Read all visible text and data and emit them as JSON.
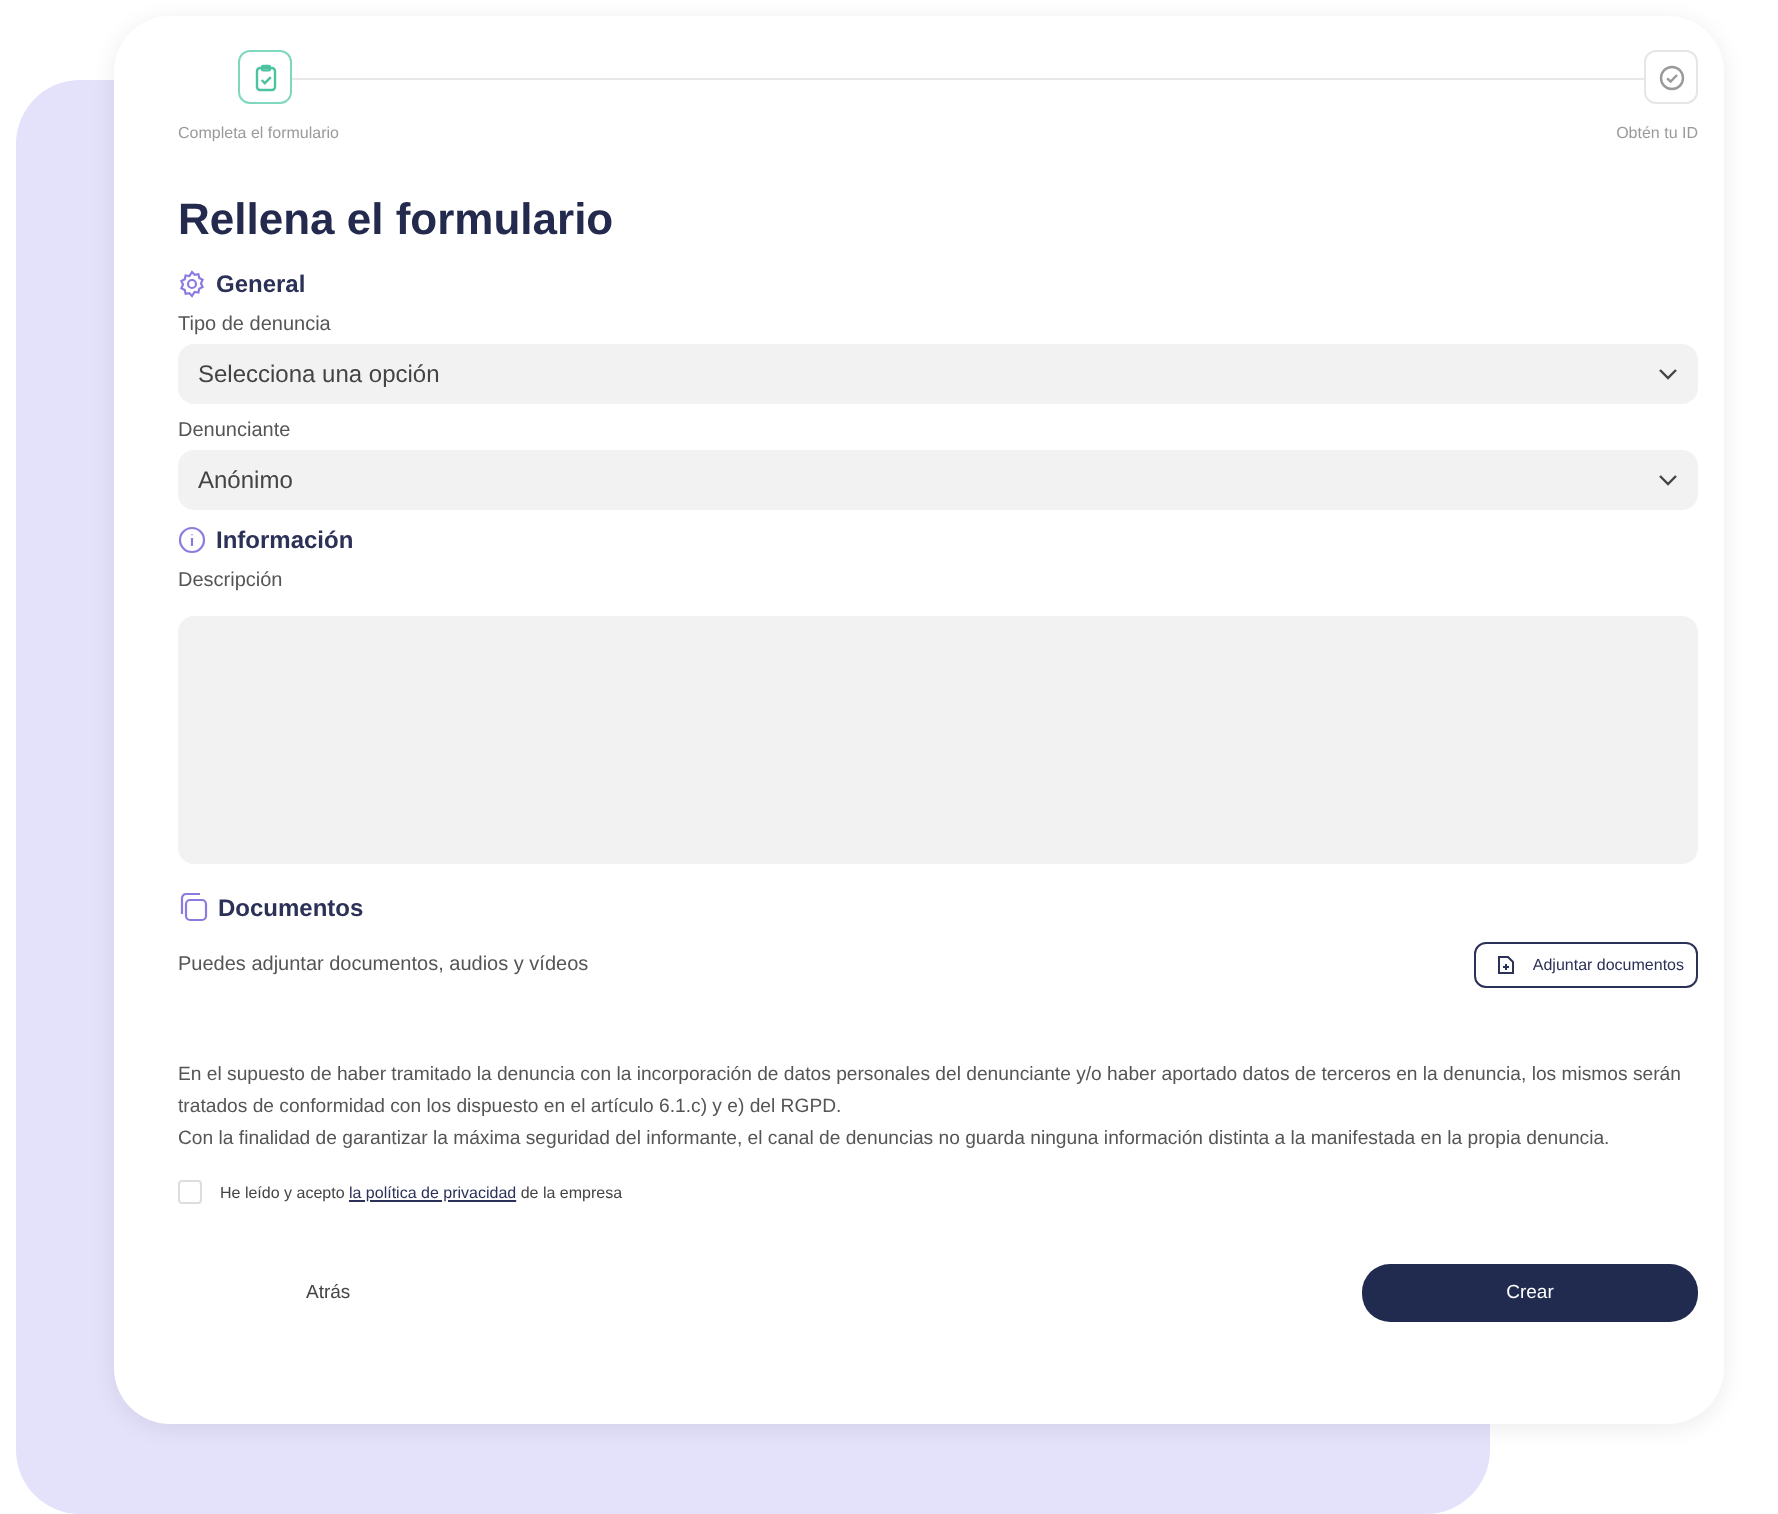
{
  "steps": [
    {
      "label": "Completa el formulario",
      "kind": "form",
      "current": true
    },
    {
      "label": "Obtén tu ID",
      "kind": "id",
      "current": false
    }
  ],
  "title": "Rellena el formulario",
  "sections": [
    {
      "kind": "general",
      "heading": "General",
      "fields": [
        {
          "kind": "select",
          "label": "Tipo de denuncia",
          "value": "Selecciona una opción"
        },
        {
          "kind": "select",
          "label": "Denunciante",
          "value": "Anónimo"
        }
      ]
    },
    {
      "kind": "info",
      "heading": "Información",
      "fields": [
        {
          "kind": "textarea",
          "label": "Descripción"
        }
      ]
    },
    {
      "kind": "docs",
      "heading": "Documentos",
      "fields": [
        {
          "kind": "attach",
          "label": "Puedes adjuntar documentos, audios y vídeos",
          "button": "Adjuntar documentos"
        }
      ]
    }
  ],
  "legal": [
    "En el supuesto de haber tramitado la denuncia con la incorporación de datos personales del denunciante y/o haber aportado datos de terceros en la denuncia, los mismos serán tratados de conformidad con los dispuesto en el artículo 6.1.c) y e) del RGPD.",
    "Con la finalidad de garantizar la máxima seguridad del informante, el canal de denuncias no guarda ninguna información distinta a la manifestada en la propia denuncia."
  ],
  "consent": {
    "checked": false,
    "before": "He leído y acepto",
    "link": "la política de privacidad",
    "after": "de la empresa"
  },
  "back_button": "Atrás",
  "create_button": "Crear"
}
